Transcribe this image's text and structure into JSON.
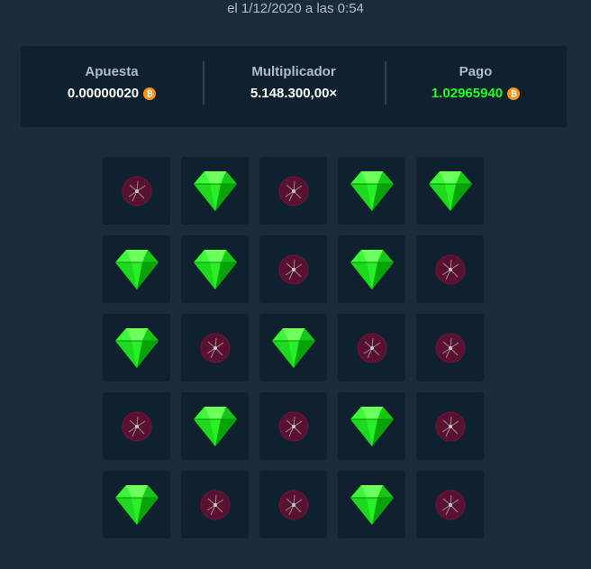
{
  "header": {
    "date_text": "el 1/12/2020 a las 0:54"
  },
  "stats": {
    "bet_label": "Apuesta",
    "bet_value": "0.00000020",
    "multiplier_label": "Multiplicador",
    "multiplier_value": "5.148.300,00×",
    "payout_label": "Pago",
    "payout_value": "1.02965940",
    "currency_icon": "bitcoin-icon",
    "currency_symbol": "₿"
  },
  "colors": {
    "background": "#1a2c38",
    "panel": "#0f212e",
    "payout_green": "#1fff20",
    "gem_green": "#00e701",
    "mine_red": "#5a1030",
    "coin_orange": "#f7931a"
  },
  "board": {
    "columns": 5,
    "tiles": [
      "mine",
      "gem",
      "mine",
      "gem",
      "gem",
      "gem",
      "gem",
      "mine",
      "gem",
      "mine",
      "gem",
      "mine",
      "gem",
      "mine",
      "mine",
      "mine",
      "gem",
      "mine",
      "gem",
      "mine",
      "gem",
      "mine",
      "mine",
      "gem",
      "mine"
    ]
  }
}
